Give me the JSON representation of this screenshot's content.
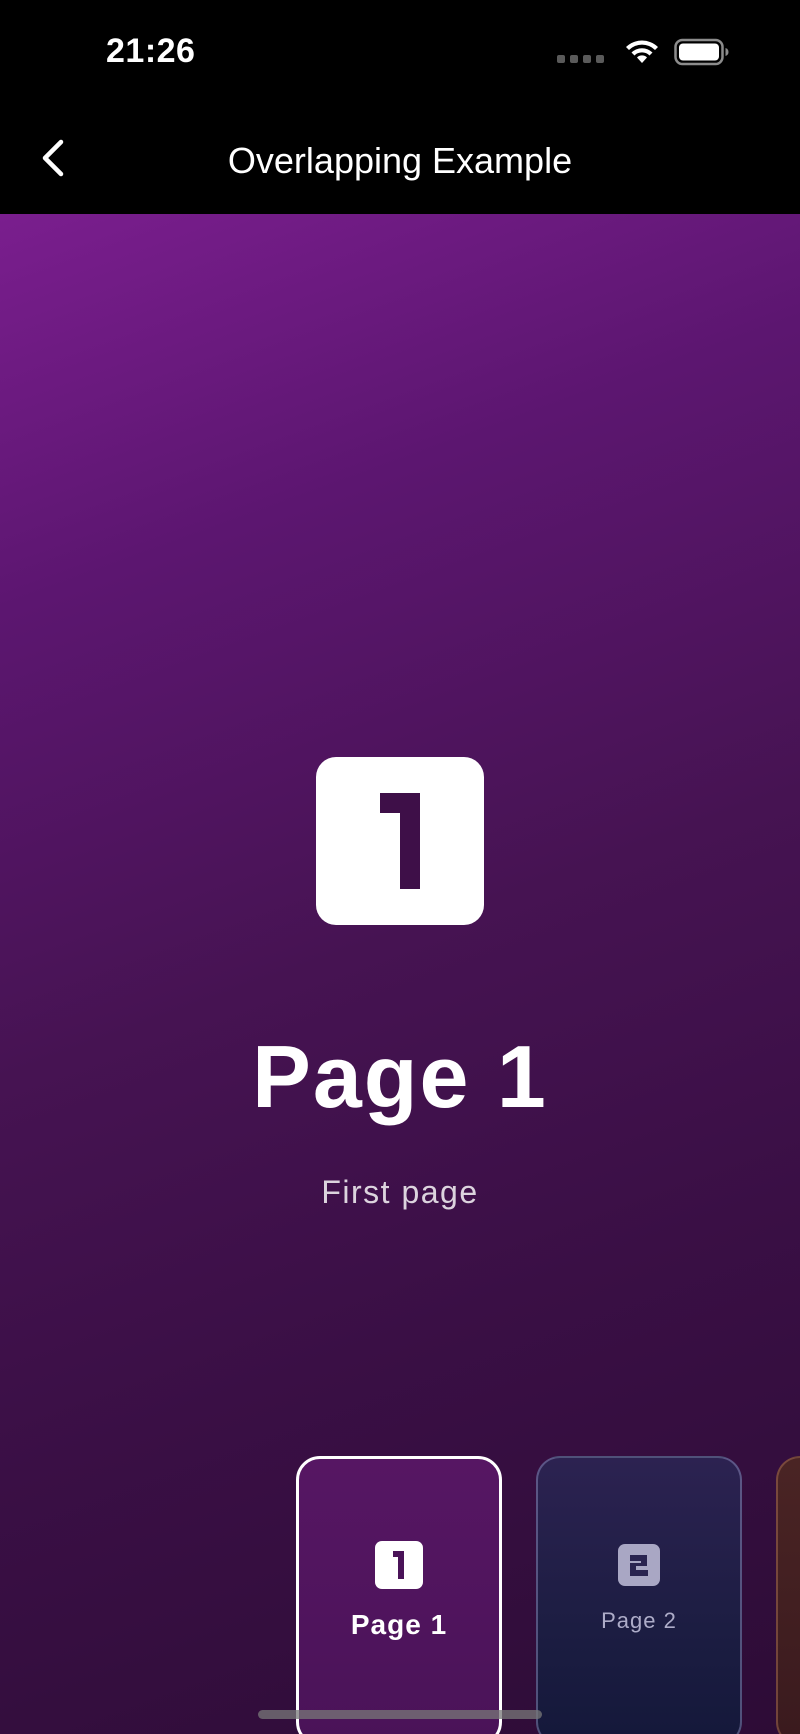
{
  "status_bar": {
    "time": "21:26",
    "icons": [
      "cellular-signal-icon",
      "wifi-icon",
      "battery-icon"
    ]
  },
  "nav": {
    "back_icon": "chevron-left-icon",
    "title": "Overlapping Example"
  },
  "page": {
    "number": "1",
    "title": "Page 1",
    "subtitle": "First page",
    "gradient": [
      "#7a1e8e",
      "#461352",
      "#2d0c36"
    ]
  },
  "thumbnails": [
    {
      "number": "1",
      "label": "Page 1",
      "selected": true,
      "color": "#561663"
    },
    {
      "number": "2",
      "label": "Page 2",
      "selected": false,
      "color": "#1c1d42"
    },
    {
      "number": "",
      "label": "",
      "selected": false,
      "color": "#4a2424"
    }
  ]
}
